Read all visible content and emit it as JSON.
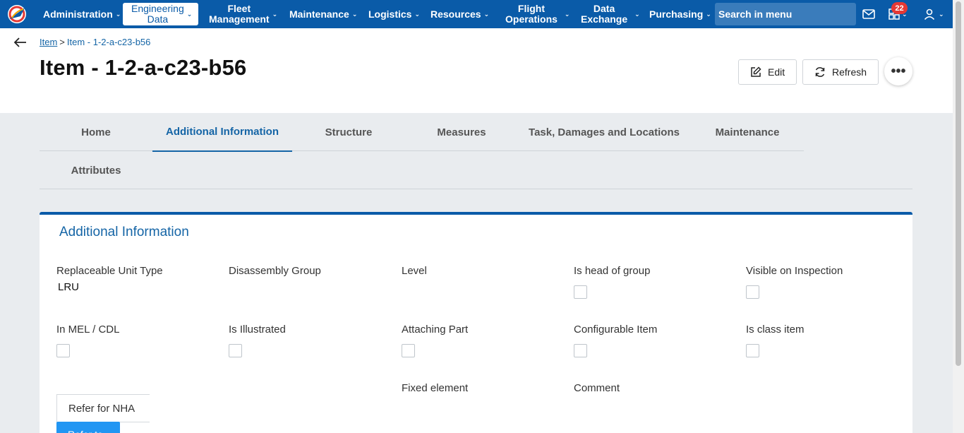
{
  "nav": {
    "items": [
      {
        "label": "Administration"
      },
      {
        "label": "Engineering Data",
        "line1": "Engineering",
        "line2": "Data"
      },
      {
        "line1": "Fleet",
        "line2": "Management"
      },
      {
        "label": "Maintenance"
      },
      {
        "label": "Logistics"
      },
      {
        "label": "Resources"
      },
      {
        "line1": "Flight",
        "line2": "Operations"
      },
      {
        "line1": "Data",
        "line2": "Exchange"
      },
      {
        "label": "Purchasing"
      }
    ],
    "search_placeholder": "Search in menu",
    "notification_count": "22",
    "icons": [
      "logo-icon",
      "mail-icon",
      "apps-icon",
      "user-icon"
    ]
  },
  "breadcrumb": {
    "parent": "Item",
    "separator": ">",
    "current": "Item - 1-2-a-c23-b56"
  },
  "page": {
    "title": "Item - 1-2-a-c23-b56",
    "edit_label": "Edit",
    "refresh_label": "Refresh",
    "more_label": "•••"
  },
  "tabs": [
    {
      "label": "Home"
    },
    {
      "label": "Additional Information",
      "active": true
    },
    {
      "label": "Structure"
    },
    {
      "label": "Measures"
    },
    {
      "label": "Task, Damages and Locations"
    },
    {
      "label": "Maintenance"
    },
    {
      "label": "Attributes"
    }
  ],
  "panel": {
    "title": "Additional Information",
    "fields": {
      "replaceable_unit_type": {
        "label": "Replaceable Unit Type",
        "value": "LRU"
      },
      "disassembly_group": {
        "label": "Disassembly Group"
      },
      "level": {
        "label": "Level"
      },
      "is_head_of_group": {
        "label": "Is head of group",
        "checked": false
      },
      "visible_on_inspection": {
        "label": "Visible on Inspection",
        "checked": false
      },
      "in_mel_cdl": {
        "label": "In MEL / CDL",
        "checked": false
      },
      "is_illustrated": {
        "label": "Is Illustrated",
        "checked": false
      },
      "attaching_part": {
        "label": "Attaching Part",
        "checked": false
      },
      "configurable_item": {
        "label": "Configurable Item",
        "checked": false
      },
      "is_class_item": {
        "label": "Is class item",
        "checked": false
      },
      "fixed_element": {
        "label": "Fixed element"
      },
      "comment": {
        "label": "Comment"
      }
    },
    "refer_for_nha": "Refer for NHA",
    "refer_to_label": "Refer to"
  },
  "colors": {
    "nav_bg": "#0a5ba8",
    "accent": "#1565a6",
    "primary_button": "#2196f3",
    "badge": "#e53935"
  }
}
